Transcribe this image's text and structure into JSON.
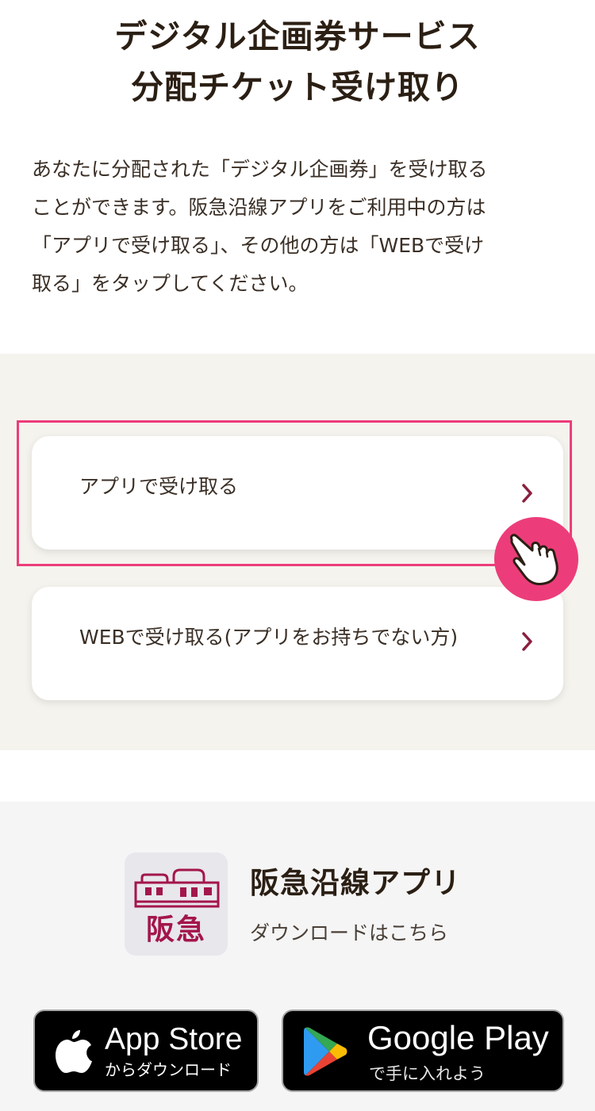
{
  "header": {
    "title_line1": "デジタル企画券サービス",
    "title_line2": "分配チケット受け取り"
  },
  "intro": {
    "lines": [
      "あなたに分配された「デジタル企画券」を受け取る",
      "ことができます。阪急沿線アプリをご利用中の方は",
      "「アプリで受け取る」、その他の方は「WEBで受け",
      "取る」をタップしてください。"
    ]
  },
  "options": {
    "app_label": "アプリで受け取る",
    "web_label": "WEBで受け取る(アプリをお持ちでない方)"
  },
  "app_promo": {
    "logo_text": "阪急",
    "name": "阪急沿線アプリ",
    "download_hint": "ダウンロードはこちら"
  },
  "stores": {
    "apple": {
      "main": "App Store",
      "sub": "からダウンロード"
    },
    "google": {
      "main": "Google Play",
      "sub": "で手に入れよう"
    }
  },
  "colors": {
    "accent": "#ec3d7a",
    "brand": "#a3164b",
    "chevron": "#8a1f3e",
    "panel_bg": "#f5f3ee"
  },
  "icons": {
    "option_arrow": "chevron-right-icon",
    "tap_hint": "pointing-hand-icon",
    "apple": "apple-logo-icon",
    "google": "google-play-icon"
  }
}
